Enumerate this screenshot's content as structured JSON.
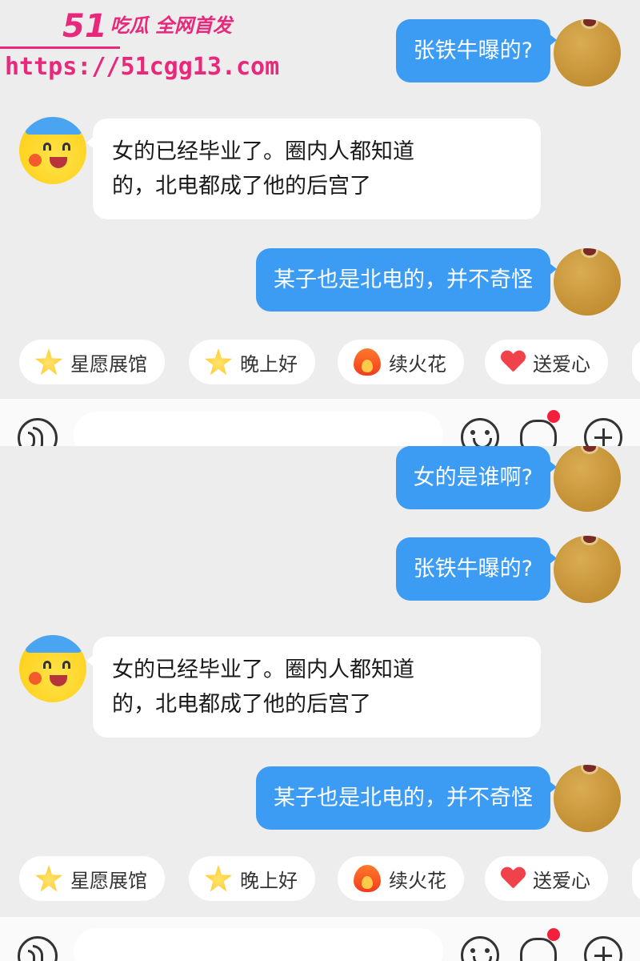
{
  "watermark": {
    "brand_number": "51",
    "brand_tag": "吃瓜 全网首发",
    "url": "https://51cgg13.com"
  },
  "screens": [
    {
      "messages": [
        {
          "side": "out",
          "text": "张铁牛曝的?"
        },
        {
          "side": "in",
          "lines": [
            "女的已经毕业了。圈内人都知道",
            "的，北电都成了他的后宫了"
          ]
        },
        {
          "side": "out",
          "text": "某子也是北电的，并不奇怪"
        }
      ]
    },
    {
      "messages": [
        {
          "side": "out",
          "text": "女的是谁啊?"
        },
        {
          "side": "out",
          "text": "张铁牛曝的?"
        },
        {
          "side": "in",
          "lines": [
            "女的已经毕业了。圈内人都知道",
            "的，北电都成了他的后宫了"
          ]
        },
        {
          "side": "out",
          "text": "某子也是北电的，并不奇怪"
        }
      ]
    }
  ],
  "quick_replies": [
    {
      "label": "星愿展馆",
      "icon": "star-face-icon"
    },
    {
      "label": "晚上好",
      "icon": "star-smile-icon"
    },
    {
      "label": "续火花",
      "icon": "fire-icon"
    },
    {
      "label": "送爱心",
      "icon": "heart-icon"
    }
  ],
  "input_bar": {
    "voice_icon": "voice-icon",
    "emoji_icon": "emoji-icon",
    "sticker_icon": "sticker-icon",
    "plus_icon": "plus-icon",
    "notification_dot_color": "#f2203a"
  },
  "colors": {
    "outgoing_bubble": "#3c9bf2",
    "incoming_bubble": "#ffffff",
    "background": "#ededed",
    "watermark": "#e8287a"
  }
}
